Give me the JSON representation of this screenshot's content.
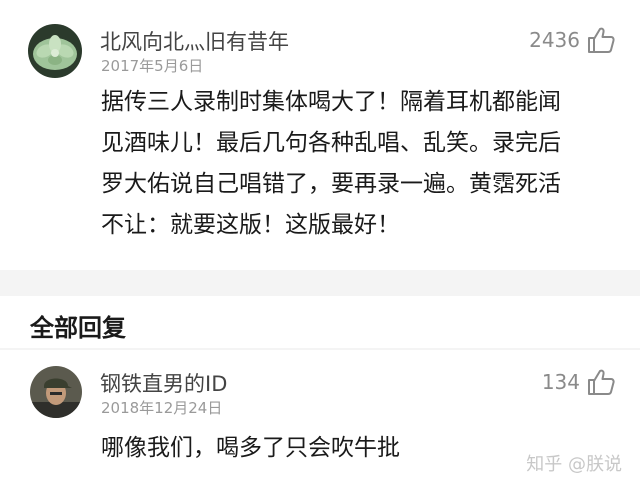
{
  "comment": {
    "username": "北风向北灬旧有昔年",
    "date": "2017年5月6日",
    "likes": "2436",
    "lines": [
      "据传三人录制时集体喝大了！隔着耳机都能闻",
      "见酒味儿！最后几句各种乱唱、乱笑。录完后",
      "罗大佑说自己唱错了，要再录一遍。黄霑死活",
      "不让：就要这版！这版最好！"
    ]
  },
  "section_title": "全部回复",
  "reply": {
    "username": "钢铁直男的ID",
    "date": "2018年12月24日",
    "likes": "134",
    "text": "哪像我们，喝多了只会吹牛批"
  },
  "watermark": "知乎 @朕说",
  "colors": {
    "background": "#f4f4f4",
    "card": "#ffffff",
    "text": "#1a1a1a",
    "meta": "#9a9a9a"
  }
}
